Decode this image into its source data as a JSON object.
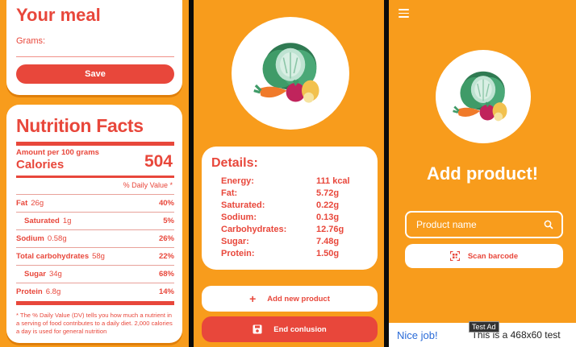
{
  "meal": {
    "title": "Your meal",
    "grams_label": "Grams:",
    "save_label": "Save"
  },
  "nutrition": {
    "title": "Nutrition Facts",
    "amount_per": "Amount per 100 grams",
    "calories_label": "Calories",
    "calories_value": "504",
    "daily_value_header": "% Daily Value *",
    "rows": [
      {
        "name": "Fat",
        "amount": "26g",
        "pct": "40%",
        "indent": false
      },
      {
        "name": "Saturated",
        "amount": "1g",
        "pct": "5%",
        "indent": true
      },
      {
        "name": "Sodium",
        "amount": "0.58g",
        "pct": "26%",
        "indent": false
      },
      {
        "name": "Total carbohydrates",
        "amount": "58g",
        "pct": "22%",
        "indent": false
      },
      {
        "name": "Sugar",
        "amount": "34g",
        "pct": "68%",
        "indent": true
      },
      {
        "name": "Protein",
        "amount": "6.8g",
        "pct": "14%",
        "indent": false
      }
    ],
    "footnote": "* The % Daily Value (DV) tells you how much a nutrient in a serving of food contributes to a daily diet. 2,000 calories a day is used for general nutrition"
  },
  "details": {
    "title": "Details:",
    "rows": [
      {
        "label": "Energy:",
        "value": "111 kcal"
      },
      {
        "label": "Fat:",
        "value": "5.72g"
      },
      {
        "label": "Saturated:",
        "value": "0.22g"
      },
      {
        "label": "Sodium:",
        "value": "0.13g"
      },
      {
        "label": "Carbohydrates:",
        "value": "12.76g"
      },
      {
        "label": "Sugar:",
        "value": "7.48g"
      },
      {
        "label": "Protein:",
        "value": "1.50g"
      }
    ],
    "add_new_label": "Add new product",
    "end_label": "End conlusion"
  },
  "add_product": {
    "title": "Add product!",
    "search_placeholder": "Product name",
    "scan_label": "Scan barcode"
  },
  "ad": {
    "nice_job": "Nice job!",
    "test_ad": "Test Ad",
    "text": "This is a 468x60 test"
  },
  "colors": {
    "background": "#f89c1c",
    "accent": "#e8473b",
    "card": "#ffffff"
  }
}
